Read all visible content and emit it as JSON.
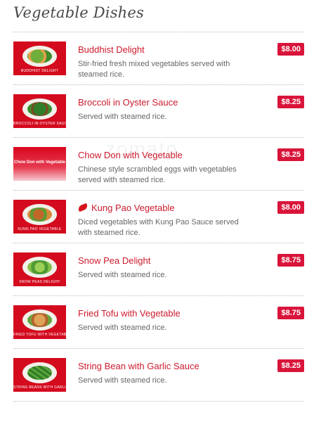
{
  "section_title": "Vegetable Dishes",
  "watermark": "zomato",
  "items": [
    {
      "name": "Buddhist Delight",
      "desc": "Stir-fried fresh mixed vegetables served with steamed rice.",
      "price": "$8.00",
      "thumb_caption": "BUDDHIST DELIGHT"
    },
    {
      "name": "Broccoli in Oyster Sauce",
      "desc": "Served with steamed rice.",
      "price": "$8.25",
      "thumb_caption": "BROCCOLI IN OYSTER SAUCE"
    },
    {
      "name": "Chow Don with Vegetable",
      "desc": "Chinese style scrambled eggs with vegetables served with steamed rice.",
      "price": "$8.25",
      "thumb_caption": "Chow Don with Vegetable"
    },
    {
      "name": "Kung Pao Vegetable",
      "desc": "Diced vegetables with Kung Pao Sauce served with steamed rice.",
      "price": "$8.00",
      "thumb_caption": "KUNG PAO VEGETABLE",
      "spicy_icon": "chili-icon"
    },
    {
      "name": "Snow Pea Delight",
      "desc": "Served with steamed rice.",
      "price": "$8.75",
      "thumb_caption": "SNOW PEAS DELIGHT"
    },
    {
      "name": "Fried Tofu with Vegetable",
      "desc": "Served with steamed rice.",
      "price": "$8.75",
      "thumb_caption": "FRIED TOFU WITH VEGETABLE"
    },
    {
      "name": "String Bean with Garlic Sauce",
      "desc": "Served with steamed rice.",
      "price": "$8.25",
      "thumb_caption": "STRING BEANS WITH GARLIC SAUCE"
    }
  ],
  "colors": {
    "accent": "#cc1a2d",
    "price_badge": "#d9143a",
    "thumb_bg": "#d40a1e"
  }
}
